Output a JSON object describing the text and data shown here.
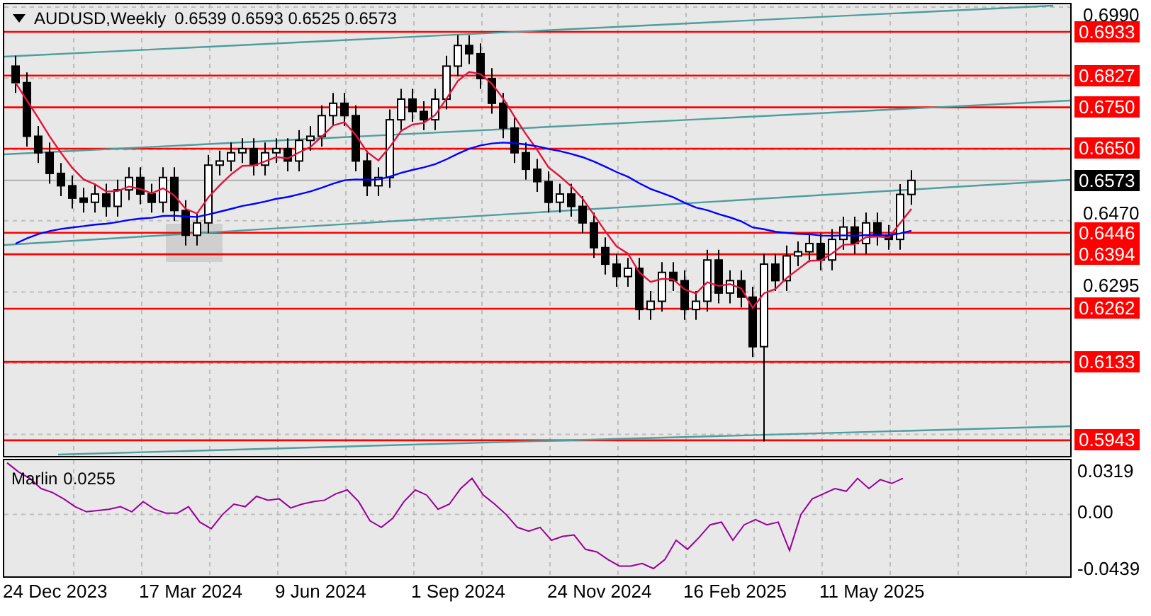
{
  "header": {
    "symbol": "AUDUSD,Weekly",
    "ohlc": "0.6539 0.6593 0.6525 0.6573"
  },
  "price_axis": {
    "ticks": [
      "0.6990",
      "0.6470",
      "0.6295"
    ],
    "levels": [
      {
        "label": "0.6933",
        "color": "#ff0000"
      },
      {
        "label": "0.6827",
        "color": "#ff0000"
      },
      {
        "label": "0.6750",
        "color": "#ff0000"
      },
      {
        "label": "0.6650",
        "color": "#ff0000"
      },
      {
        "label": "0.6573",
        "color": "#000000"
      },
      {
        "label": "0.6446",
        "color": "#ff0000"
      },
      {
        "label": "0.6394",
        "color": "#ff0000"
      },
      {
        "label": "0.6262",
        "color": "#ff0000"
      },
      {
        "label": "0.6133",
        "color": "#ff0000"
      },
      {
        "label": "0.5943",
        "color": "#ff0000"
      }
    ]
  },
  "indicator": {
    "reading": "0.0255",
    "chart_data": {
      "type": "line",
      "ylim": [
        -0.048,
        0.042
      ],
      "grid": true,
      "yticks": [
        {
          "value": 0.0319,
          "label": "0.0319"
        },
        {
          "value": 0,
          "label": "0.00"
        },
        {
          "value": -0.0439,
          "label": "-0.0439"
        }
      ],
      "series": [
        {
          "name": "Marlin",
          "color": "#990099",
          "values": [
            0.04,
            0.033,
            0.028,
            0.02,
            0.017,
            0.012,
            0.006,
            0.002,
            0.003,
            0.004,
            0.006,
            0.002,
            0.01,
            0.004,
            0.001,
            0.001,
            0.006,
            -0.006,
            -0.011,
            0.0,
            0.008,
            0.006,
            0.014,
            0.011,
            0.012,
            0.005,
            0.008,
            0.01,
            0.011,
            0.016,
            0.019,
            0.01,
            -0.005,
            -0.01,
            -0.003,
            0.01,
            0.019,
            0.015,
            0.004,
            0.008,
            0.02,
            0.028,
            0.015,
            0.008,
            0.0,
            -0.01,
            -0.013,
            -0.01,
            -0.02,
            -0.017,
            -0.016,
            -0.027,
            -0.029,
            -0.035,
            -0.04,
            -0.04,
            -0.038,
            -0.042,
            -0.035,
            -0.02,
            -0.027,
            -0.018,
            -0.008,
            -0.006,
            -0.02,
            -0.008,
            -0.004,
            -0.008,
            -0.006,
            -0.028,
            0.0,
            0.012,
            0.016,
            0.02,
            0.018,
            0.028,
            0.02,
            0.027,
            0.024,
            0.028
          ]
        }
      ]
    }
  },
  "time_axis": [
    "24 Dec 2023",
    "17 Mar 2024",
    "9 Jun 2024",
    "1 Sep 2024",
    "24 Nov 2024",
    "16 Feb 2025",
    "11 May 2025"
  ]
}
